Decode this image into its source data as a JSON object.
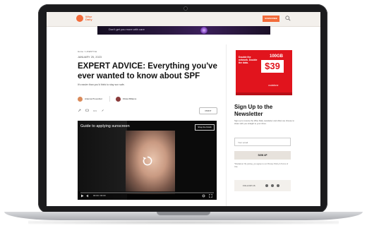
{
  "site": {
    "logo_text": "Wise Daily",
    "subscribe_label": "SUBSCRIBE"
  },
  "top_ad": {
    "text": "Don't get you more with care"
  },
  "article": {
    "breadcrumb": "Home > LIFESTYLE",
    "date": "JANUARY 25, 2023",
    "title": "EXPERT ADVICE: Everything you've ever wanted to know about SPF",
    "summary": "It's easier than you'd think to stay sun safe.",
    "authors": [
      {
        "name": "Arianna Provenbol",
        "avatar_color": "#d98a5a"
      },
      {
        "name": "Olivia Williams",
        "avatar_color": "#8a3b3b"
      }
    ],
    "share_count": "101",
    "print_label": "PRINT"
  },
  "video": {
    "title": "Guide to applying sunscreen",
    "external_label": "Shop the Finish",
    "time": "00:00 / 00:00",
    "progress": 0.0
  },
  "sidebar_ad": {
    "headline": "Double the network. Double the data.",
    "data": "100GB",
    "price": "$39",
    "brand": "vodafone"
  },
  "newsletter": {
    "title": "Sign Up to the Newsletter",
    "description": "Sign up to receive the Wise Daily newsletter and offers we choose to share with you straight to your inbox.",
    "email_placeholder": "Your email",
    "button_label": "SIGN UP",
    "disclaimer": "*Disclaimer: By joining, you agree to our Privacy Policy & Terms of Use.",
    "follow_label": "FOLLOW US"
  },
  "colors": {
    "brand": "#f26b3a",
    "ad_red": "#e1141d"
  }
}
